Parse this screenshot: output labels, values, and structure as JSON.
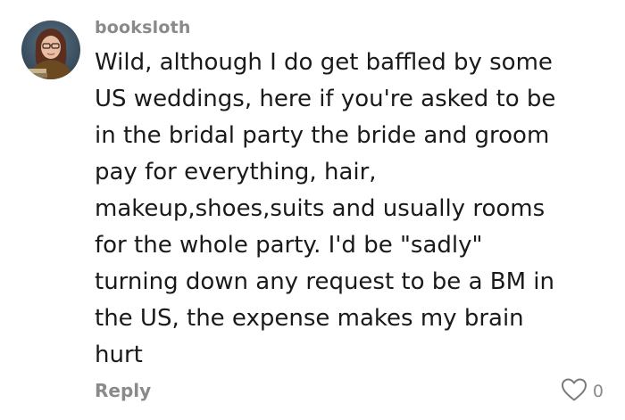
{
  "comment": {
    "username": "booksloth",
    "text_lines": [
      "Wild, although I do get baffled by some",
      "US weddings, here if you're asked to be",
      "in the bridal party the bride and groom",
      "pay for everything, hair,",
      "makeup,shoes,suits and usually rooms",
      "for the whole party. I'd be \"sadly\"",
      "turning down any request to be a BM in",
      "the US, the expense makes my brain",
      "hurt"
    ],
    "reply_label": "Reply",
    "like_count": "0",
    "avatar_icon": "user-avatar-photo",
    "like_icon": "heart-outline-icon"
  }
}
